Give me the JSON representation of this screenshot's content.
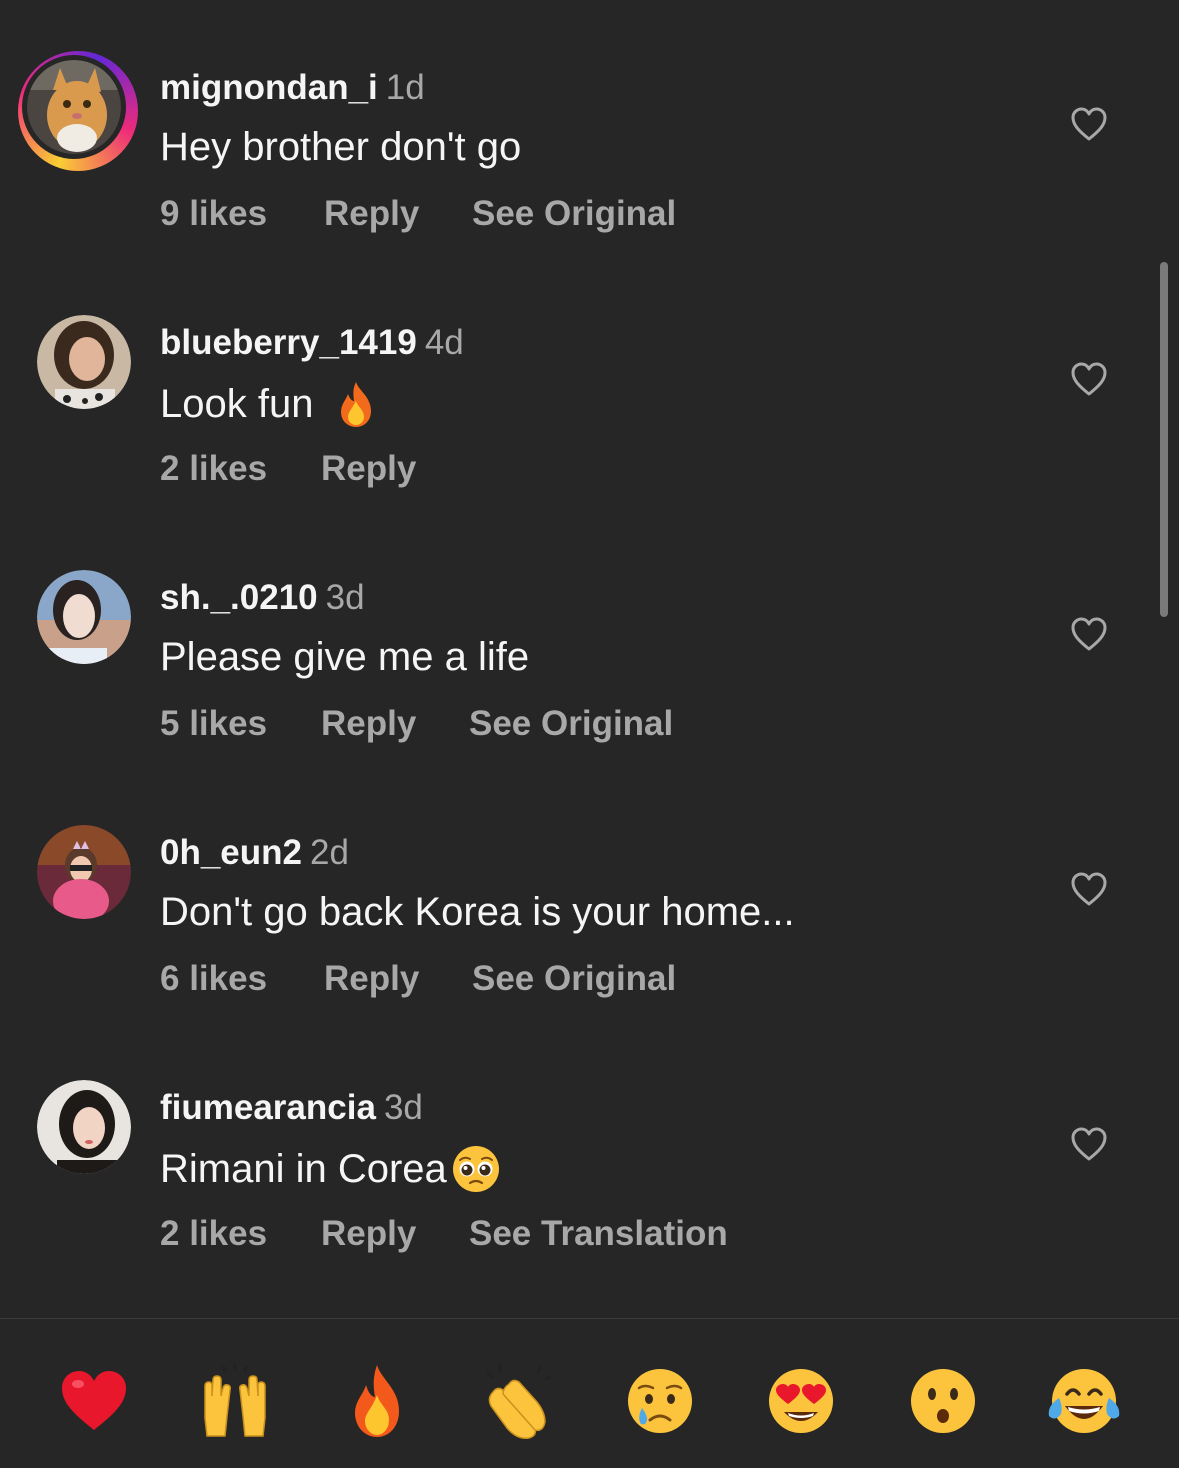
{
  "comments": [
    {
      "username": "mignondan_i",
      "time": "1d",
      "text": "Hey brother don't go",
      "likes": "9 likes",
      "reply": "Reply",
      "extra": "See Original",
      "has_story": true
    },
    {
      "username": "blueberry_1419",
      "time": "4d",
      "text": "Look fun",
      "emoji": "fire",
      "likes": "2 likes",
      "reply": "Reply",
      "extra": ""
    },
    {
      "username": "sh._.0210",
      "time": "3d",
      "text": "Please give me a life",
      "likes": "5 likes",
      "reply": "Reply",
      "extra": "See Original"
    },
    {
      "username": "0h_eun2",
      "time": "2d",
      "text": "Don't go back Korea is your home...",
      "likes": "6 likes",
      "reply": "Reply",
      "extra": "See Original"
    },
    {
      "username": "fiumearancia",
      "time": "3d",
      "text": "Rimani in Corea",
      "emoji": "pleading-face",
      "likes": "2 likes",
      "reply": "Reply",
      "extra": "See Translation"
    }
  ],
  "quick_reactions": [
    "❤️",
    "🙌",
    "🔥",
    "👏",
    "😢",
    "😍",
    "😮",
    "😂"
  ],
  "reaction_names": [
    "red-heart",
    "raising-hands",
    "fire",
    "clapping-hands",
    "crying-face",
    "heart-eyes",
    "surprised-face",
    "tears-of-joy"
  ],
  "colors": {
    "background": "#262626",
    "text_primary": "#f5f5f5",
    "text_secondary": "#a8a8a8"
  }
}
